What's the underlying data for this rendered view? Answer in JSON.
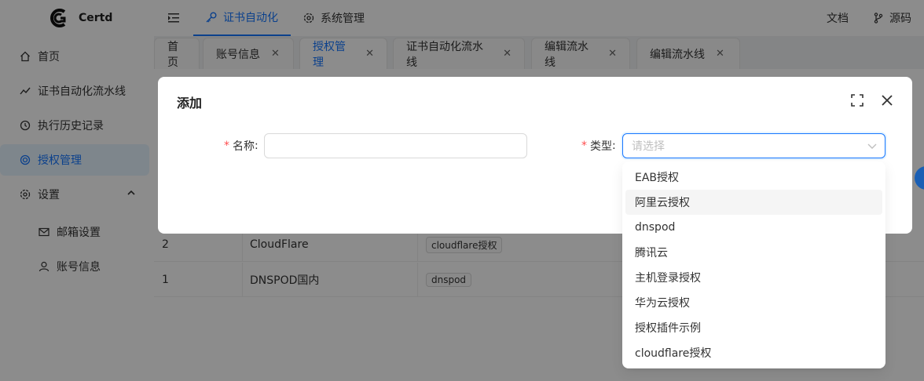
{
  "app": {
    "name": "Certd"
  },
  "header": {
    "menu": [
      {
        "label": "证书自动化",
        "icon": "key-icon",
        "active": true
      },
      {
        "label": "系统管理",
        "icon": "gear-icon",
        "active": false
      }
    ],
    "right": [
      {
        "label": "文档",
        "icon": ""
      },
      {
        "label": "源码",
        "icon": "branch-icon"
      }
    ]
  },
  "sidebar": {
    "items": [
      {
        "label": "首页",
        "icon": "home-icon"
      },
      {
        "label": "证书自动化流水线",
        "icon": "trend-icon"
      },
      {
        "label": "执行历史记录",
        "icon": "history-icon"
      },
      {
        "label": "授权管理",
        "icon": "target-icon",
        "active": true
      },
      {
        "label": "设置",
        "icon": "gear-icon"
      },
      {
        "label": "邮箱设置",
        "icon": "mail-icon"
      },
      {
        "label": "账号信息",
        "icon": "user-icon"
      }
    ]
  },
  "tabs": [
    {
      "label": "首页",
      "closable": false
    },
    {
      "label": "账号信息",
      "closable": true
    },
    {
      "label": "授权管理",
      "closable": true,
      "active": true
    },
    {
      "label": "证书自动化流水线",
      "closable": true
    },
    {
      "label": "编辑流水线",
      "closable": true
    },
    {
      "label": "编辑流水线",
      "closable": true
    }
  ],
  "table": {
    "rows": [
      {
        "id": "2",
        "name": "CloudFlare",
        "type": "cloudflare授权"
      },
      {
        "id": "1",
        "name": "DNSPOD国内",
        "type": "dnspod"
      }
    ]
  },
  "modal": {
    "title": "添加",
    "fields": {
      "name": {
        "label": "名称",
        "suffix": ":",
        "value": ""
      },
      "type": {
        "label": "类型",
        "suffix": ":",
        "placeholder": "请选择"
      }
    },
    "options": [
      "EAB授权",
      "阿里云授权",
      "dnspod",
      "腾讯云",
      "主机登录授权",
      "华为云授权",
      "授权插件示例",
      "cloudflare授权"
    ],
    "hovered_option": 1
  },
  "colors": {
    "accent": "#1677ff",
    "required": "#ff4d4f"
  }
}
